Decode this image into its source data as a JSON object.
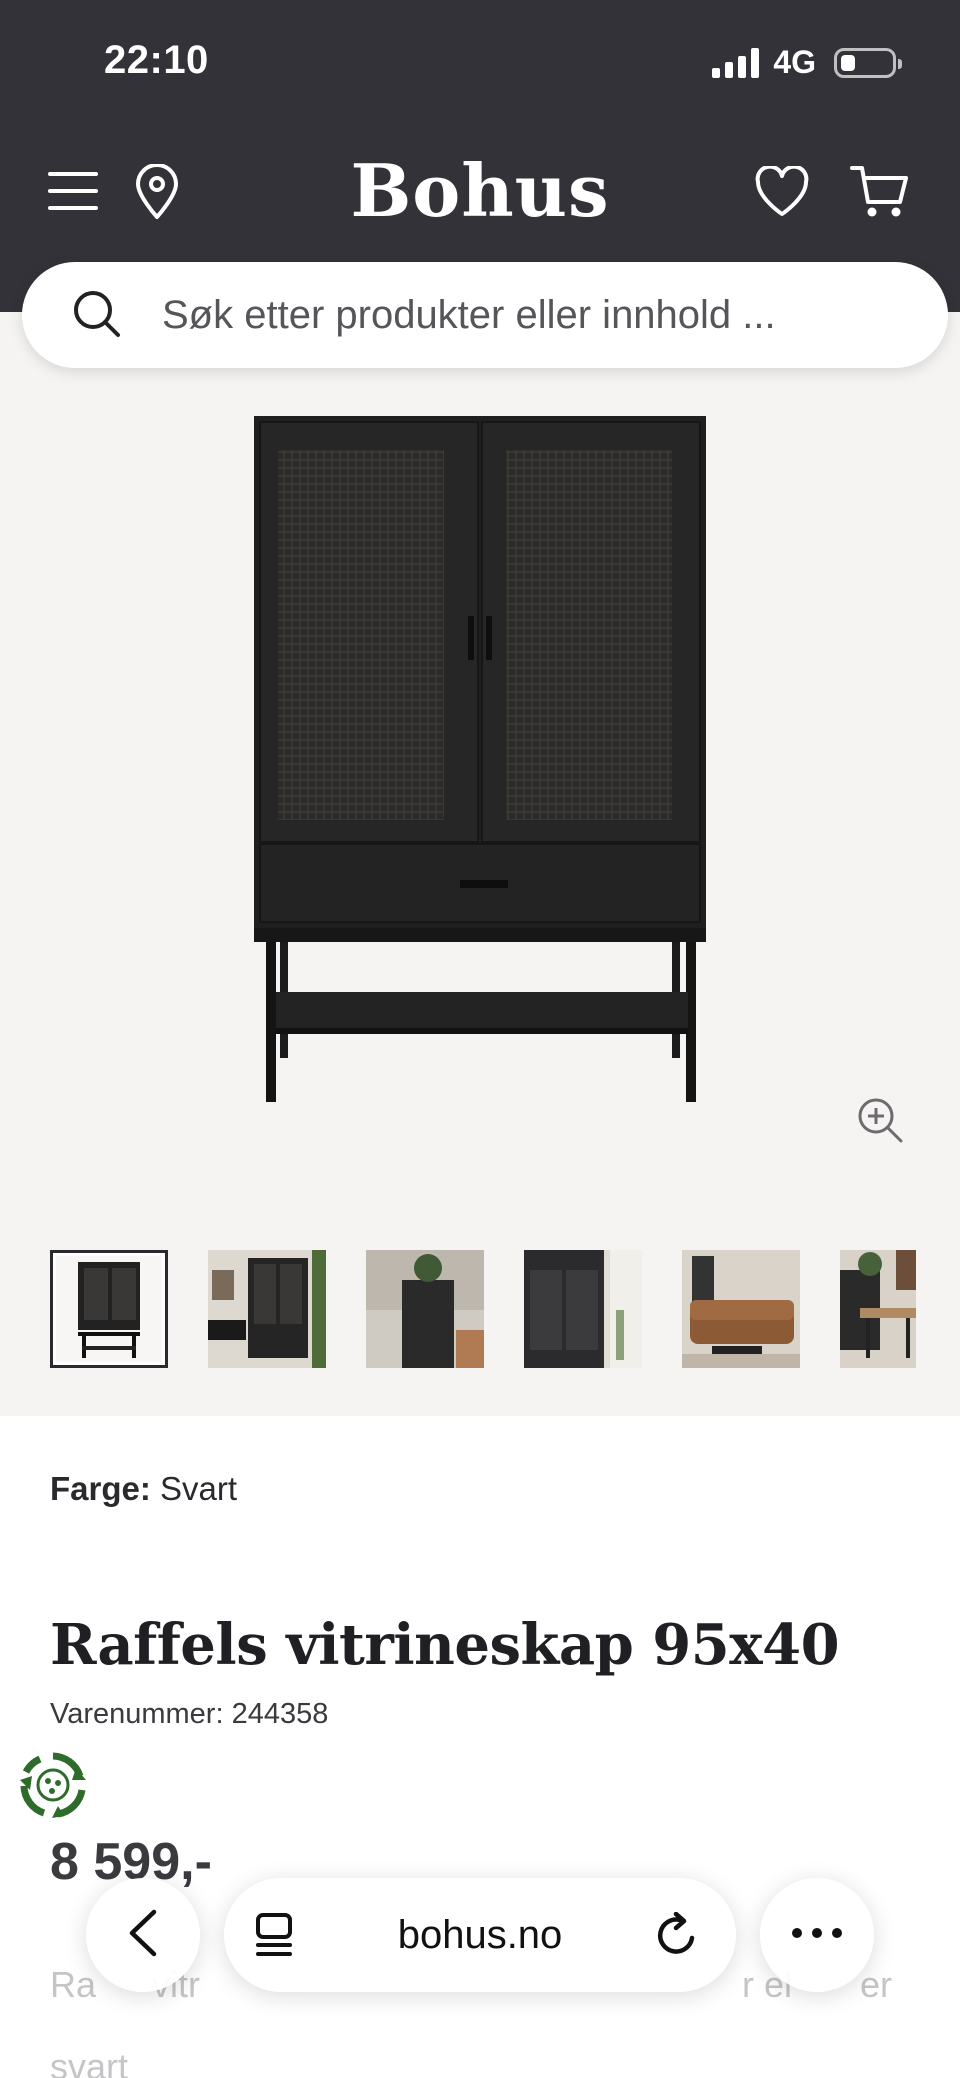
{
  "status_bar": {
    "time": "22:10",
    "network": "4G"
  },
  "header": {
    "brand": "Bohus",
    "icons": [
      "menu-icon",
      "location-pin-icon",
      "heart-icon",
      "cart-icon"
    ]
  },
  "search": {
    "placeholder": "Søk etter produkter eller innhold ..."
  },
  "gallery": {
    "thumbnails": [
      "thumb-1",
      "thumb-2",
      "thumb-3",
      "thumb-4",
      "thumb-5",
      "thumb-6"
    ],
    "active_index": 0
  },
  "product": {
    "color_label": "Farge:",
    "color_value": "Svart",
    "title": "Raffels vitrineskap 95x40",
    "sku_label": "Varenummer:",
    "sku": "244358",
    "price": "8 599,-",
    "description_fragment_1": "Ra",
    "description_fragment_2": "vitr",
    "description_fragment_3": "r el",
    "description_fragment_4": "er",
    "description_line_2": "svart"
  },
  "browser": {
    "url": "bohus.no"
  },
  "colors": {
    "header_bg": "#333238",
    "gallery_bg": "#f5f4f2",
    "text": "#2a2a2e"
  }
}
